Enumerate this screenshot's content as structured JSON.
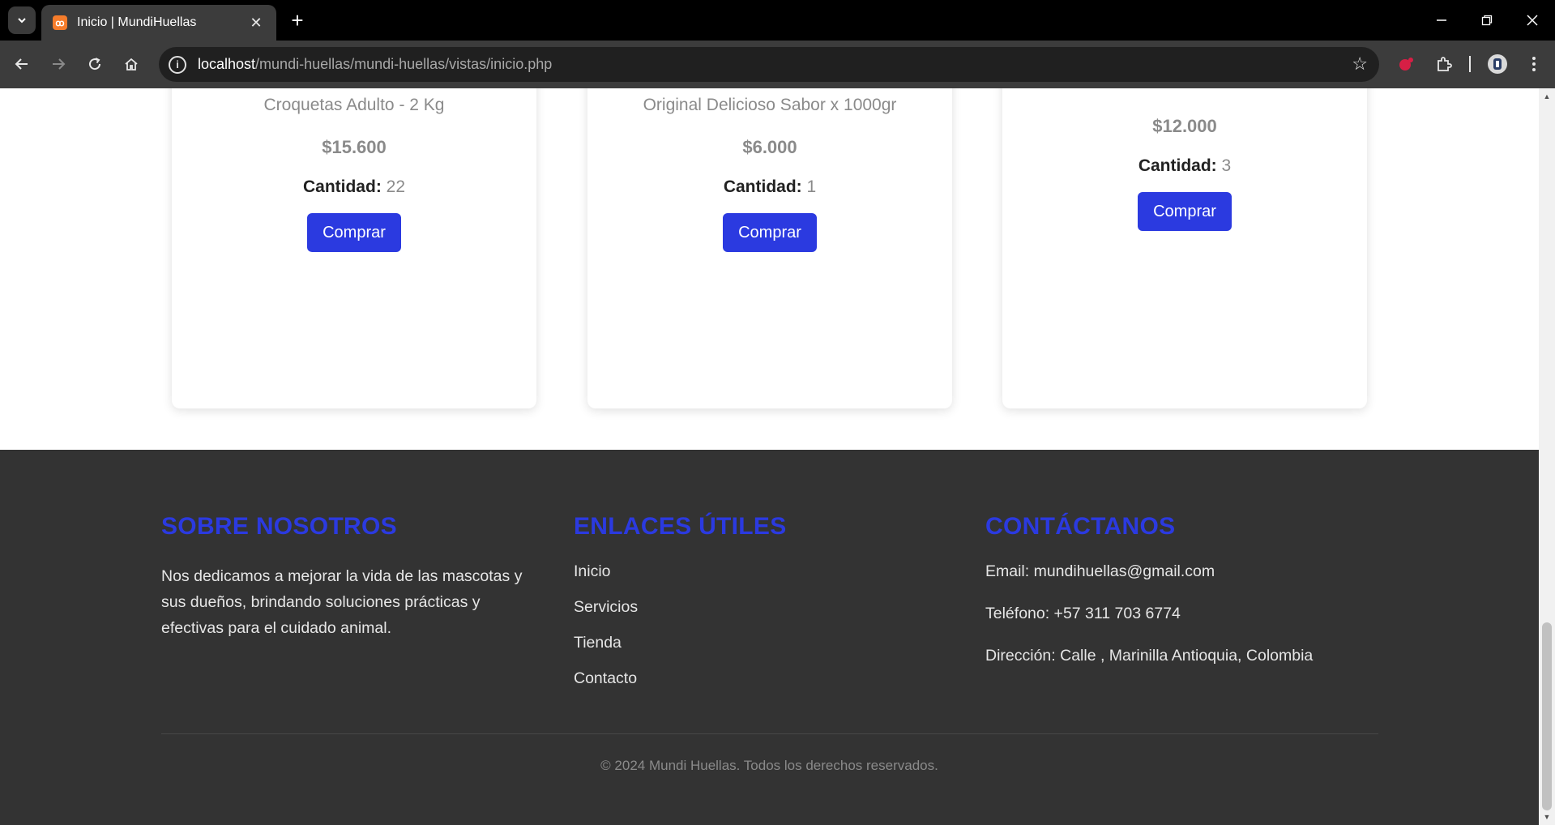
{
  "browser": {
    "tab_title": "Inicio | MundiHuellas",
    "url_host": "localhost",
    "url_path": "/mundi-huellas/mundi-huellas/vistas/inicio.php"
  },
  "products": [
    {
      "name": "Croquetas Adulto - 2 Kg",
      "price": "$15.600",
      "qty_label": "Cantidad:",
      "qty_value": "22",
      "button_label": "Comprar"
    },
    {
      "name": "Original Delicioso Sabor x 1000gr",
      "price": "$6.000",
      "qty_label": "Cantidad:",
      "qty_value": "1",
      "button_label": "Comprar"
    },
    {
      "name": "",
      "price": "$12.000",
      "qty_label": "Cantidad:",
      "qty_value": "3",
      "button_label": "Comprar"
    }
  ],
  "footer": {
    "about": {
      "heading": "SOBRE NOSOTROS",
      "text": "Nos dedicamos a mejorar la vida de las mascotas y sus dueños, brindando soluciones prácticas y efectivas para el cuidado animal."
    },
    "links": {
      "heading": "ENLACES ÚTILES",
      "items": [
        "Inicio",
        "Servicios",
        "Tienda",
        "Contacto"
      ]
    },
    "contact": {
      "heading": "CONTÁCTANOS",
      "email": "Email: mundihuellas@gmail.com",
      "phone": "Teléfono: +57 311 703 6774",
      "address": "Dirección: Calle , Marinilla Antioquia, Colombia"
    },
    "copyright": "© 2024 Mundi Huellas. Todos los derechos reservados."
  },
  "colors": {
    "accent": "#2b3ae0",
    "footer_bg": "#333333"
  }
}
